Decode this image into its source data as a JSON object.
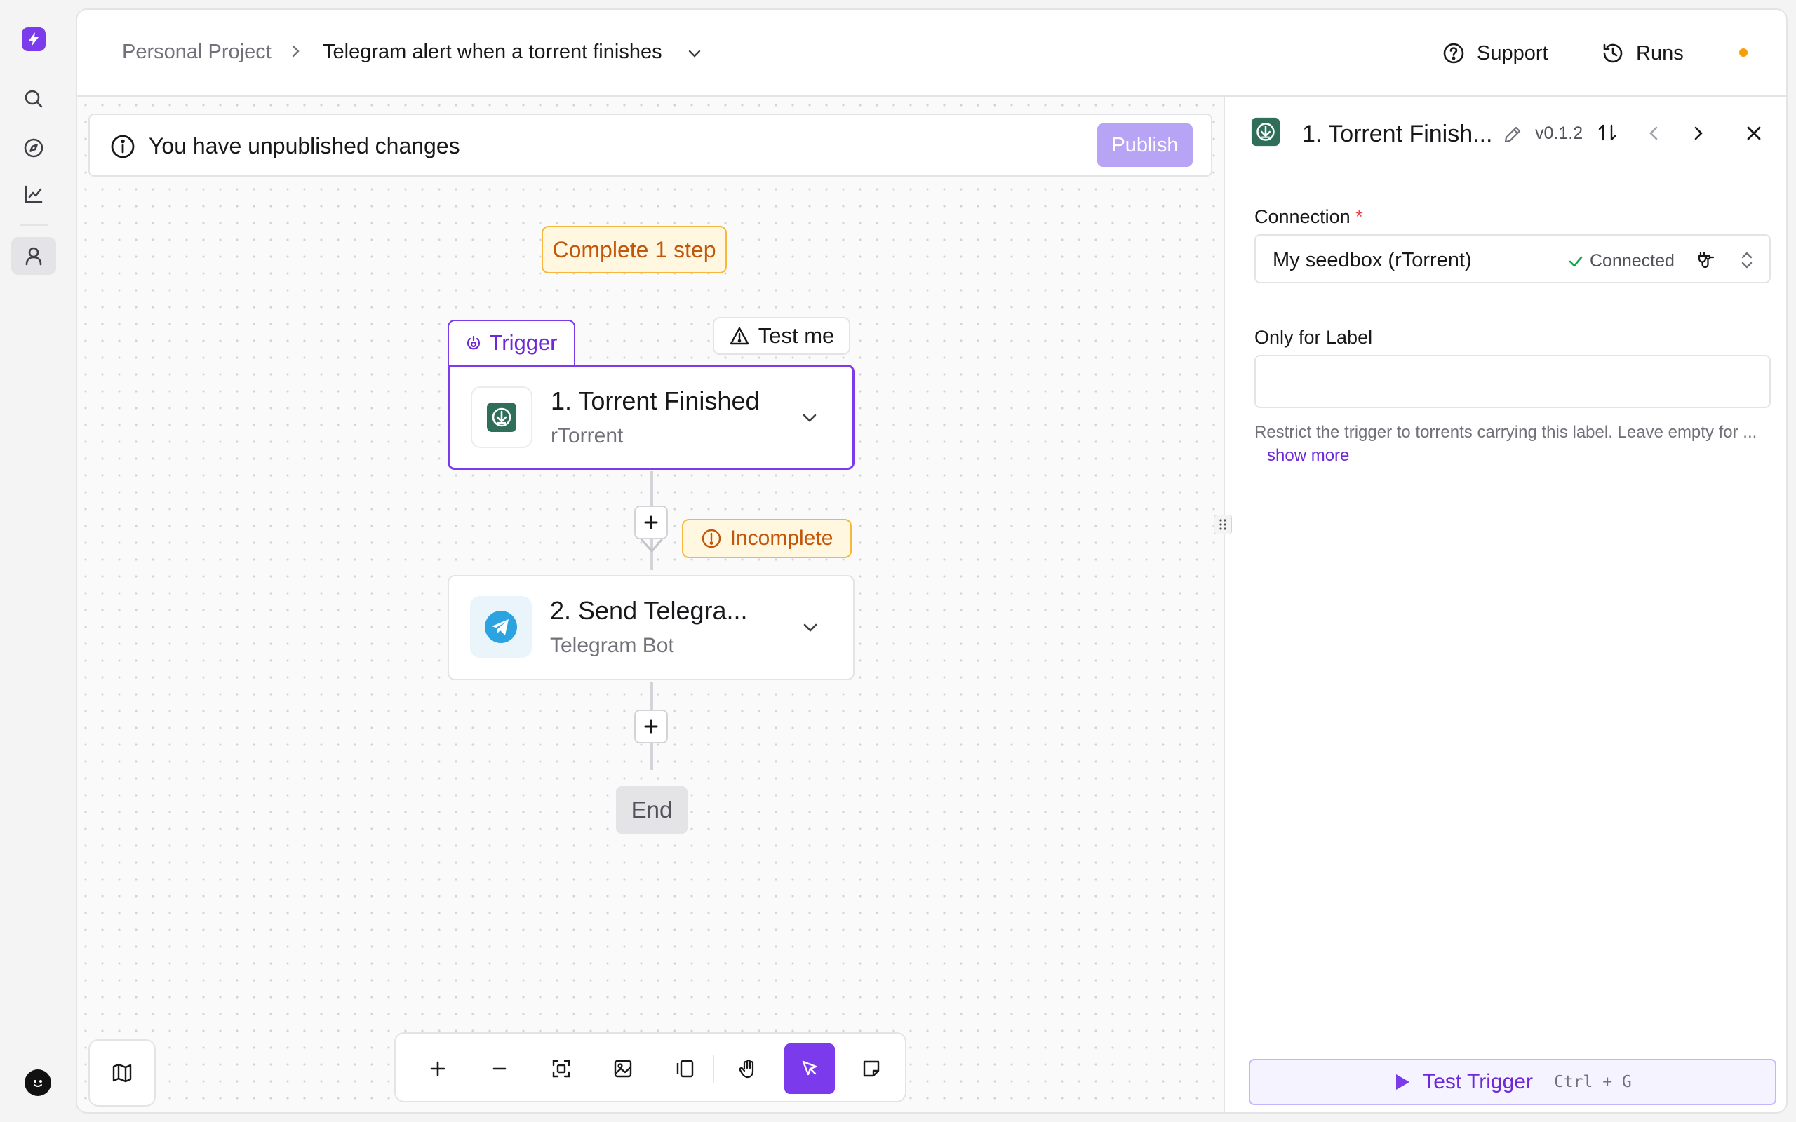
{
  "colors": {
    "accent": "#7c3aed",
    "warning_border": "#f6b73c",
    "warning_text": "#c2570c",
    "status_dot": "#f59e0b",
    "success": "#16a34a",
    "rtorrent_green": "#2f6f5a",
    "telegram_blue": "#2aa3e0"
  },
  "rail": {
    "logo_icon": "bolt-icon",
    "items": [
      {
        "name": "search",
        "icon": "search-icon"
      },
      {
        "name": "explore",
        "icon": "compass-icon"
      },
      {
        "name": "analytics",
        "icon": "chart-icon"
      },
      {
        "name": "account",
        "icon": "user-icon",
        "active": true
      }
    ],
    "avatar_icon": "smiley-avatar-icon"
  },
  "header": {
    "breadcrumb_project": "Personal Project",
    "breadcrumb_flow": "Telegram alert when a torrent finishes",
    "support_label": "Support",
    "runs_label": "Runs"
  },
  "banner": {
    "message": "You have unpublished changes",
    "publish_label": "Publish"
  },
  "canvas": {
    "complete_label": "Complete 1 step",
    "trigger_tab_label": "Trigger",
    "test_me_label": "Test me",
    "incomplete_label": "Incomplete",
    "end_label": "End",
    "steps": [
      {
        "title": "1. Torrent Finished",
        "subtitle": "rTorrent",
        "icon": "rtorrent-download-icon"
      },
      {
        "title": "2. Send Telegra...",
        "subtitle": "Telegram Bot",
        "icon": "telegram-icon"
      }
    ]
  },
  "toolbar": {
    "tools": [
      "zoom-in",
      "zoom-out",
      "fit-view",
      "export-image",
      "toggle-panel",
      "pan-hand",
      "select-pointer",
      "add-note"
    ],
    "active_tool": "select-pointer"
  },
  "panel": {
    "title": "1. Torrent Finish...",
    "version": "v0.1.2",
    "connection_label": "Connection",
    "required_mark": "*",
    "connection_value": "My seedbox (rTorrent)",
    "connection_status": "Connected",
    "label_field_label": "Only for Label",
    "label_field_value": "",
    "help_text": "Restrict the trigger to torrents carrying this label. Leave empty for ...",
    "show_more": "show more",
    "test_button_label": "Test Trigger",
    "test_shortcut": "Ctrl + G"
  }
}
